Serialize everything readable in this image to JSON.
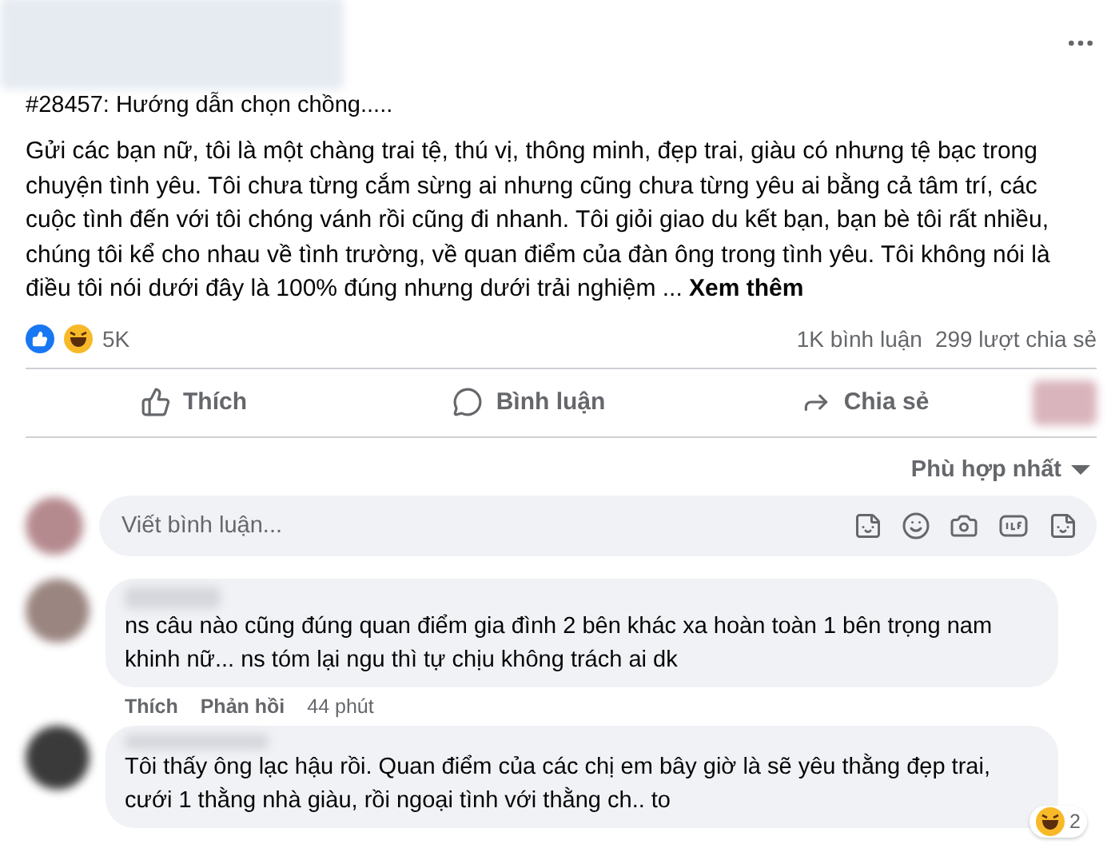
{
  "post": {
    "title": "#28457: Hướng dẫn chọn chồng.....",
    "body": "Gửi các bạn nữ, tôi là một chàng trai tệ, thú vị, thông minh, đẹp trai, giàu có nhưng tệ bạc trong chuyện tình yêu. Tôi chưa từng cắm sừng ai nhưng cũng chưa từng yêu ai bằng cả tâm trí, các cuộc tình đến với tôi chóng vánh rồi cũng đi nhanh. Tôi giỏi giao du kết bạn, bạn bè tôi rất nhiều, chúng tôi kể cho nhau về tình trường, về quan điểm của đàn ông trong tình yêu. Tôi không nói là điều tôi nói dưới đây là 100% đúng nhưng dưới trải nghiệm ...",
    "see_more": "Xem thêm"
  },
  "stats": {
    "reactions": "5K",
    "comments": "1K bình luận",
    "shares": "299 lượt chia sẻ"
  },
  "actions": [
    {
      "kind": "like",
      "label": "Thích"
    },
    {
      "kind": "comment",
      "label": "Bình luận"
    },
    {
      "kind": "share",
      "label": "Chia sẻ"
    }
  ],
  "sort": "Phù hợp nhất",
  "comment_input": {
    "placeholder": "Viết bình luận..."
  },
  "comments": [
    {
      "text": "ns câu nào cũng đúng quan điểm gia đình 2 bên khác xa hoàn toàn 1 bên trọng nam khinh nữ... ns tóm lại ngu thì tự chịu không trách ai dk",
      "like": "Thích",
      "reply": "Phản hồi",
      "time": "44 phút"
    },
    {
      "text": "Tôi thấy ông lạc hậu rồi. Quan điểm của các chị em bây giờ là sẽ yêu thằng đẹp trai, cưới 1 thằng nhà giàu, rồi ngoại tình với thằng ch.. to",
      "reaction_count": "2"
    }
  ]
}
